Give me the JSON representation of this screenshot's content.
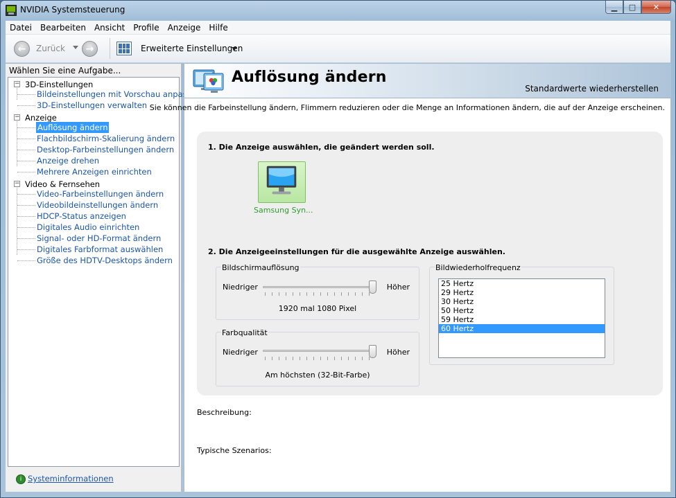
{
  "window": {
    "title": "NVIDIA Systemsteuerung"
  },
  "menu": [
    "Datei",
    "Bearbeiten",
    "Ansicht",
    "Profile",
    "Anzeige",
    "Hilfe"
  ],
  "toolbar": {
    "back_label": "Zurück",
    "advanced_label": "Erweiterte Einstellungen"
  },
  "sidebar": {
    "header": "Wählen Sie eine Aufgabe...",
    "categories": [
      {
        "label": "3D-Einstellungen",
        "children": [
          "Bildeinstellungen mit Vorschau anpassen",
          "3D-Einstellungen verwalten"
        ]
      },
      {
        "label": "Anzeige",
        "children": [
          "Auflösung ändern",
          "Flachbildschirm-Skalierung ändern",
          "Desktop-Farbeinstellungen ändern",
          "Anzeige drehen",
          "Mehrere Anzeigen einrichten"
        ]
      },
      {
        "label": "Video & Fernsehen",
        "children": [
          "Video-Farbeinstellungen ändern",
          "Videobildeinstellungen ändern",
          "HDCP-Status anzeigen",
          "Digitales Audio einrichten",
          "Signal- oder HD-Format ändern",
          "Digitales Farbformat auswählen",
          "Größe des HDTV-Desktops ändern"
        ]
      }
    ],
    "selected": "Auflösung ändern",
    "sysinfo_label": "Systeminformationen"
  },
  "page": {
    "title": "Auflösung ändern",
    "restore_label": "Standardwerte wiederherstellen",
    "intro": "Sie können die Farbeinstellung ändern, Flimmern reduzieren oder die Menge an Informationen ändern, die auf der Anzeige erscheinen.",
    "step1": "1. Die Anzeige auswählen, die geändert werden soll.",
    "display_label": "Samsung Syn...",
    "step2": "2. Die Anzeigeeinstellungen für die ausgewählte Anzeige auswählen.",
    "resolution": {
      "title": "Bildschirmauflösung",
      "low": "Niedriger",
      "high": "Höher",
      "value": "1920 mal 1080 Pixel",
      "level": 1.0
    },
    "color": {
      "title": "Farbqualität",
      "low": "Niedriger",
      "high": "Höher",
      "value": "Am höchsten (32-Bit-Farbe)",
      "level": 1.0
    },
    "refresh": {
      "title": "Bildwiederholfrequenz",
      "options": [
        "25 Hertz",
        "29 Hertz",
        "30 Hertz",
        "50 Hertz",
        "59 Hertz",
        "60 Hertz"
      ],
      "selected": "60 Hertz"
    },
    "description_label": "Beschreibung:",
    "scenarios_label": "Typische Szenarios:"
  }
}
